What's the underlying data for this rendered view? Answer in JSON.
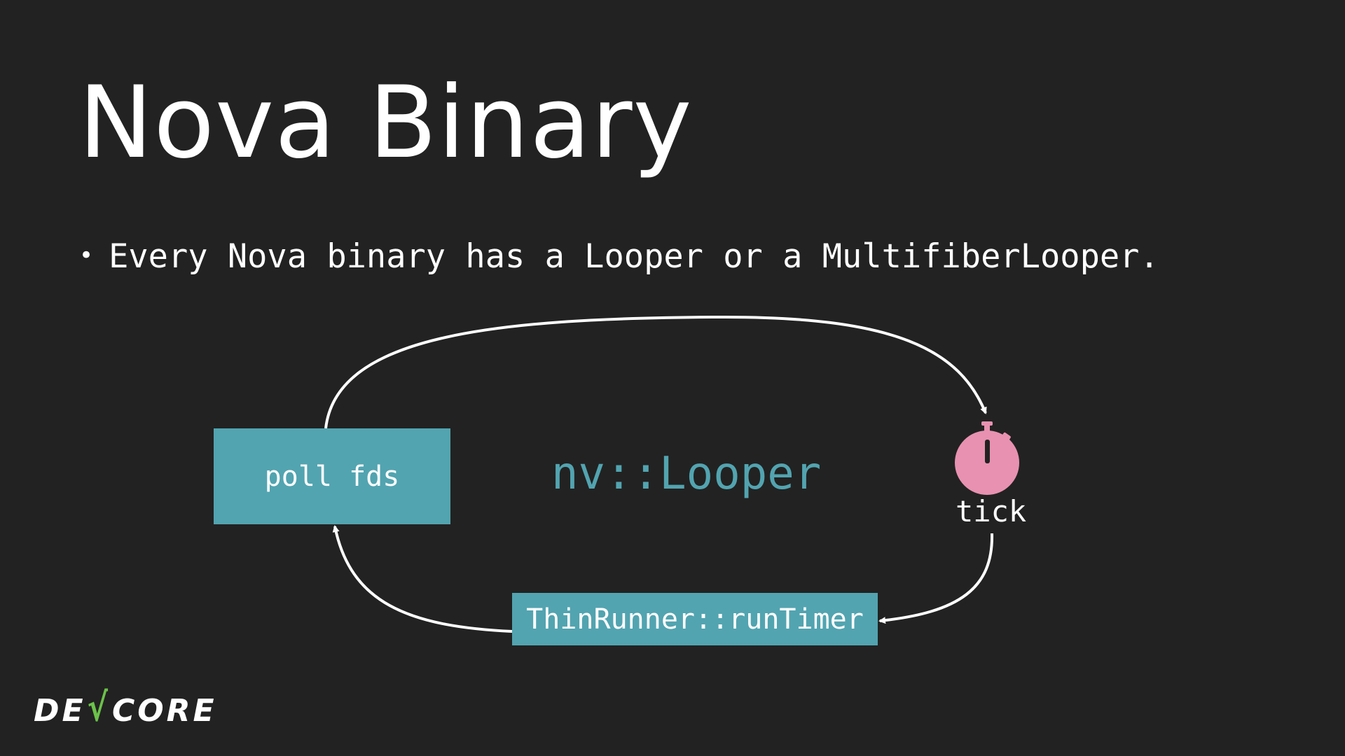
{
  "slide": {
    "title": "Nova Binary",
    "bullet": "Every Nova binary has a Looper or a MultifiberLooper."
  },
  "diagram": {
    "poll_box_label": "poll fds",
    "center_label": "nv::Looper",
    "timer_label": "tick",
    "runner_box_label": "ThinRunner::runTimer",
    "timer_icon": "stopwatch-icon",
    "colors": {
      "box_fill": "#52a4b0",
      "center_text": "#52a4b0",
      "stopwatch": "#e891b1",
      "arrows": "#ffffff",
      "background": "#222222"
    }
  },
  "logo": {
    "text_before_check": "DE",
    "check_glyph": "√",
    "text_after_check": "CORE",
    "check_color": "#6cc24a"
  }
}
